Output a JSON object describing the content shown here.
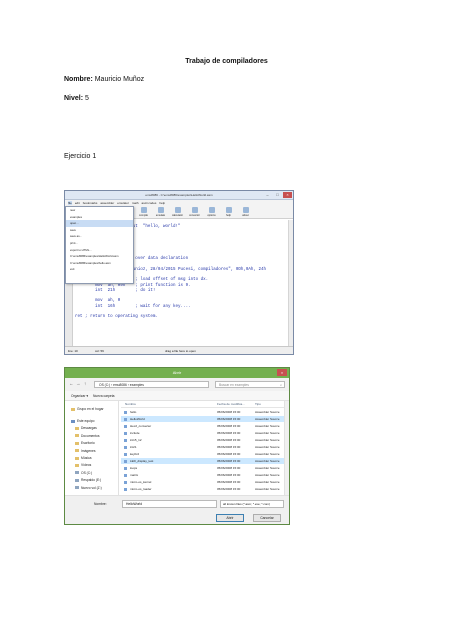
{
  "document": {
    "title": "Trabajo de compiladores",
    "name_label": "Nombre:",
    "name_value": " Mauricio Muñoz",
    "level_label": "Nivel:",
    "level_value": " 5",
    "exercise": "Ejercicio 1"
  },
  "editor": {
    "window_title": "emu8086 - C:\\emu8086\\examples\\HelloWorld.asm",
    "menu": [
      "file",
      "edit",
      "bookmarks",
      "assembler",
      "emulator",
      "math",
      "ascii codes",
      "help"
    ],
    "toolbar": [
      "new",
      "open",
      "examples",
      "save",
      "compile",
      "emulate",
      "calculator",
      "convertor",
      "options",
      "help",
      "about"
    ],
    "file_menu": [
      "new",
      "examples",
      "open...",
      "save",
      "save as...",
      "print...",
      "export to HTML...",
      "C:\\emu8086\\examples\\HelloWorld.asm",
      "C:\\emu8086\\examples\\hello.asm",
      "exit"
    ],
    "code_lines": [
      "",
      "; this example prints out  \"hello, world!\"",
      "",
      "org 100h",
      "",
      "",
      "",
      "jmp start        ; jump over data declaration",
      "",
      "msg:    db  \"Mauricio Munioz, 28/04/2015 Pucesi, compiladores\", 0Dh,0Ah, 24h",
      "",
      "start:  mov  dx, msg    ; load offset of msg into dx.",
      "        mov  ah, 09h    ; print function is 9.",
      "        int  21h        ; do it!",
      "",
      "        mov  ah, 0",
      "        int  16h        ; wait for any key....",
      "",
      "ret ; return to operating system."
    ],
    "status": {
      "line": "line: 10",
      "col": "col: 59",
      "drag": "drag a file here to open"
    }
  },
  "dialog": {
    "title": "Abrir",
    "path": "OS (C:)  ›  emu8086  ›  examples",
    "search_placeholder": "Buscar en examples",
    "organize": "Organizar ▾",
    "new_folder": "Nueva carpeta",
    "nav_items": [
      {
        "label": "Grupo en el hogar",
        "kind": "group"
      },
      {
        "label": "Este equipo",
        "kind": "pc"
      },
      {
        "label": "Descargas",
        "kind": "folder"
      },
      {
        "label": "Documentos",
        "kind": "folder"
      },
      {
        "label": "Escritorio",
        "kind": "folder"
      },
      {
        "label": "Imágenes",
        "kind": "folder"
      },
      {
        "label": "Música",
        "kind": "folder"
      },
      {
        "label": "Vídeos",
        "kind": "folder"
      },
      {
        "label": "OS (C:)",
        "kind": "drive"
      },
      {
        "label": "Respaldo (E:)",
        "kind": "drive"
      },
      {
        "label": "Nuevo vol (Z:)",
        "kind": "drive"
      }
    ],
    "columns": {
      "name": "Nombre",
      "date": "Fecha de modifica...",
      "type": "Tipo"
    },
    "files": [
      {
        "name": "hello",
        "date": "05/06/2008 15:00",
        "type": "Assembler Source"
      },
      {
        "name": "HelloWorld",
        "date": "05/06/2008 15:00",
        "type": "Assembler Source"
      },
      {
        "name": "Hex2_converter",
        "date": "05/06/2008 15:00",
        "type": "Assembler Source"
      },
      {
        "name": "include",
        "date": "05/06/2008 15:00",
        "type": "Assembler Source"
      },
      {
        "name": "int15_12",
        "date": "05/06/2008 15:00",
        "type": "Assembler Source"
      },
      {
        "name": "int21",
        "date": "05/06/2008 15:00",
        "type": "Assembler Source"
      },
      {
        "name": "keybrd",
        "date": "05/06/2008 15:00",
        "type": "Assembler Source"
      },
      {
        "name": "LED_display_test",
        "date": "05/06/2008 15:00",
        "type": "Assembler Source"
      },
      {
        "name": "loops",
        "date": "05/06/2008 15:00",
        "type": "Assembler Source"
      },
      {
        "name": "matrix",
        "date": "05/06/2008 15:00",
        "type": "Assembler Source"
      },
      {
        "name": "micro-os_kernel",
        "date": "05/06/2008 15:00",
        "type": "Assembler Source"
      },
      {
        "name": "micro-os_loader",
        "date": "05/06/2008 15:00",
        "type": "Assembler Source"
      }
    ],
    "filename_label": "Nombre:",
    "filename_value": "HelloWorld",
    "filetype": "all known files (*.asm; *.exe; *.com)",
    "open_button": "Abrir",
    "cancel_button": "Cancelar"
  }
}
